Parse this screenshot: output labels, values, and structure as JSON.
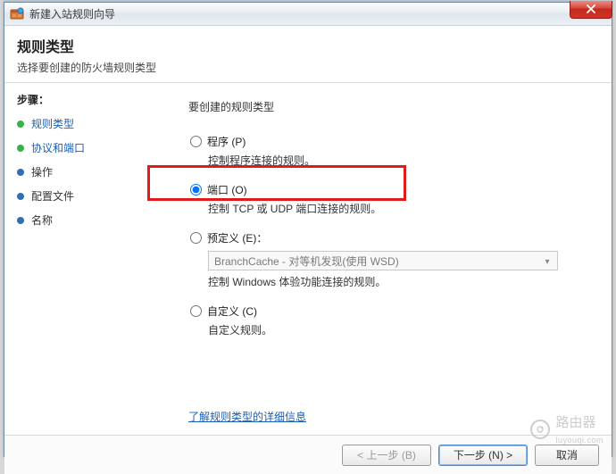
{
  "window": {
    "title": "新建入站规则向导",
    "close_label": "X"
  },
  "header": {
    "title": "规则类型",
    "subtitle": "选择要创建的防火墙规则类型"
  },
  "sidebar": {
    "heading": "步骤：",
    "items": [
      {
        "label": "规则类型",
        "state": "done",
        "link": true
      },
      {
        "label": "协议和端口",
        "state": "done",
        "link": true
      },
      {
        "label": "操作",
        "state": "todo",
        "link": false
      },
      {
        "label": "配置文件",
        "state": "todo",
        "link": false
      },
      {
        "label": "名称",
        "state": "todo",
        "link": false
      }
    ]
  },
  "main": {
    "heading": "要创建的规则类型",
    "options": {
      "program": {
        "label": "程序 (P)",
        "desc": "控制程序连接的规则。"
      },
      "port": {
        "label": "端口 (O)",
        "desc": "控制 TCP 或 UDP 端口连接的规则。"
      },
      "predefined": {
        "label": "预定义 (E)：",
        "combo_value": "BranchCache - 对等机发现(使用 WSD)",
        "desc": "控制 Windows 体验功能连接的规则。"
      },
      "custom": {
        "label": "自定义 (C)",
        "desc": "自定义规则。"
      }
    },
    "learn_more": "了解规则类型的详细信息"
  },
  "footer": {
    "back": "< 上一步 (B)",
    "next": "下一步 (N) >",
    "cancel": "取消"
  },
  "watermark": {
    "text": "路由器",
    "sub": "luyouqi.com"
  }
}
